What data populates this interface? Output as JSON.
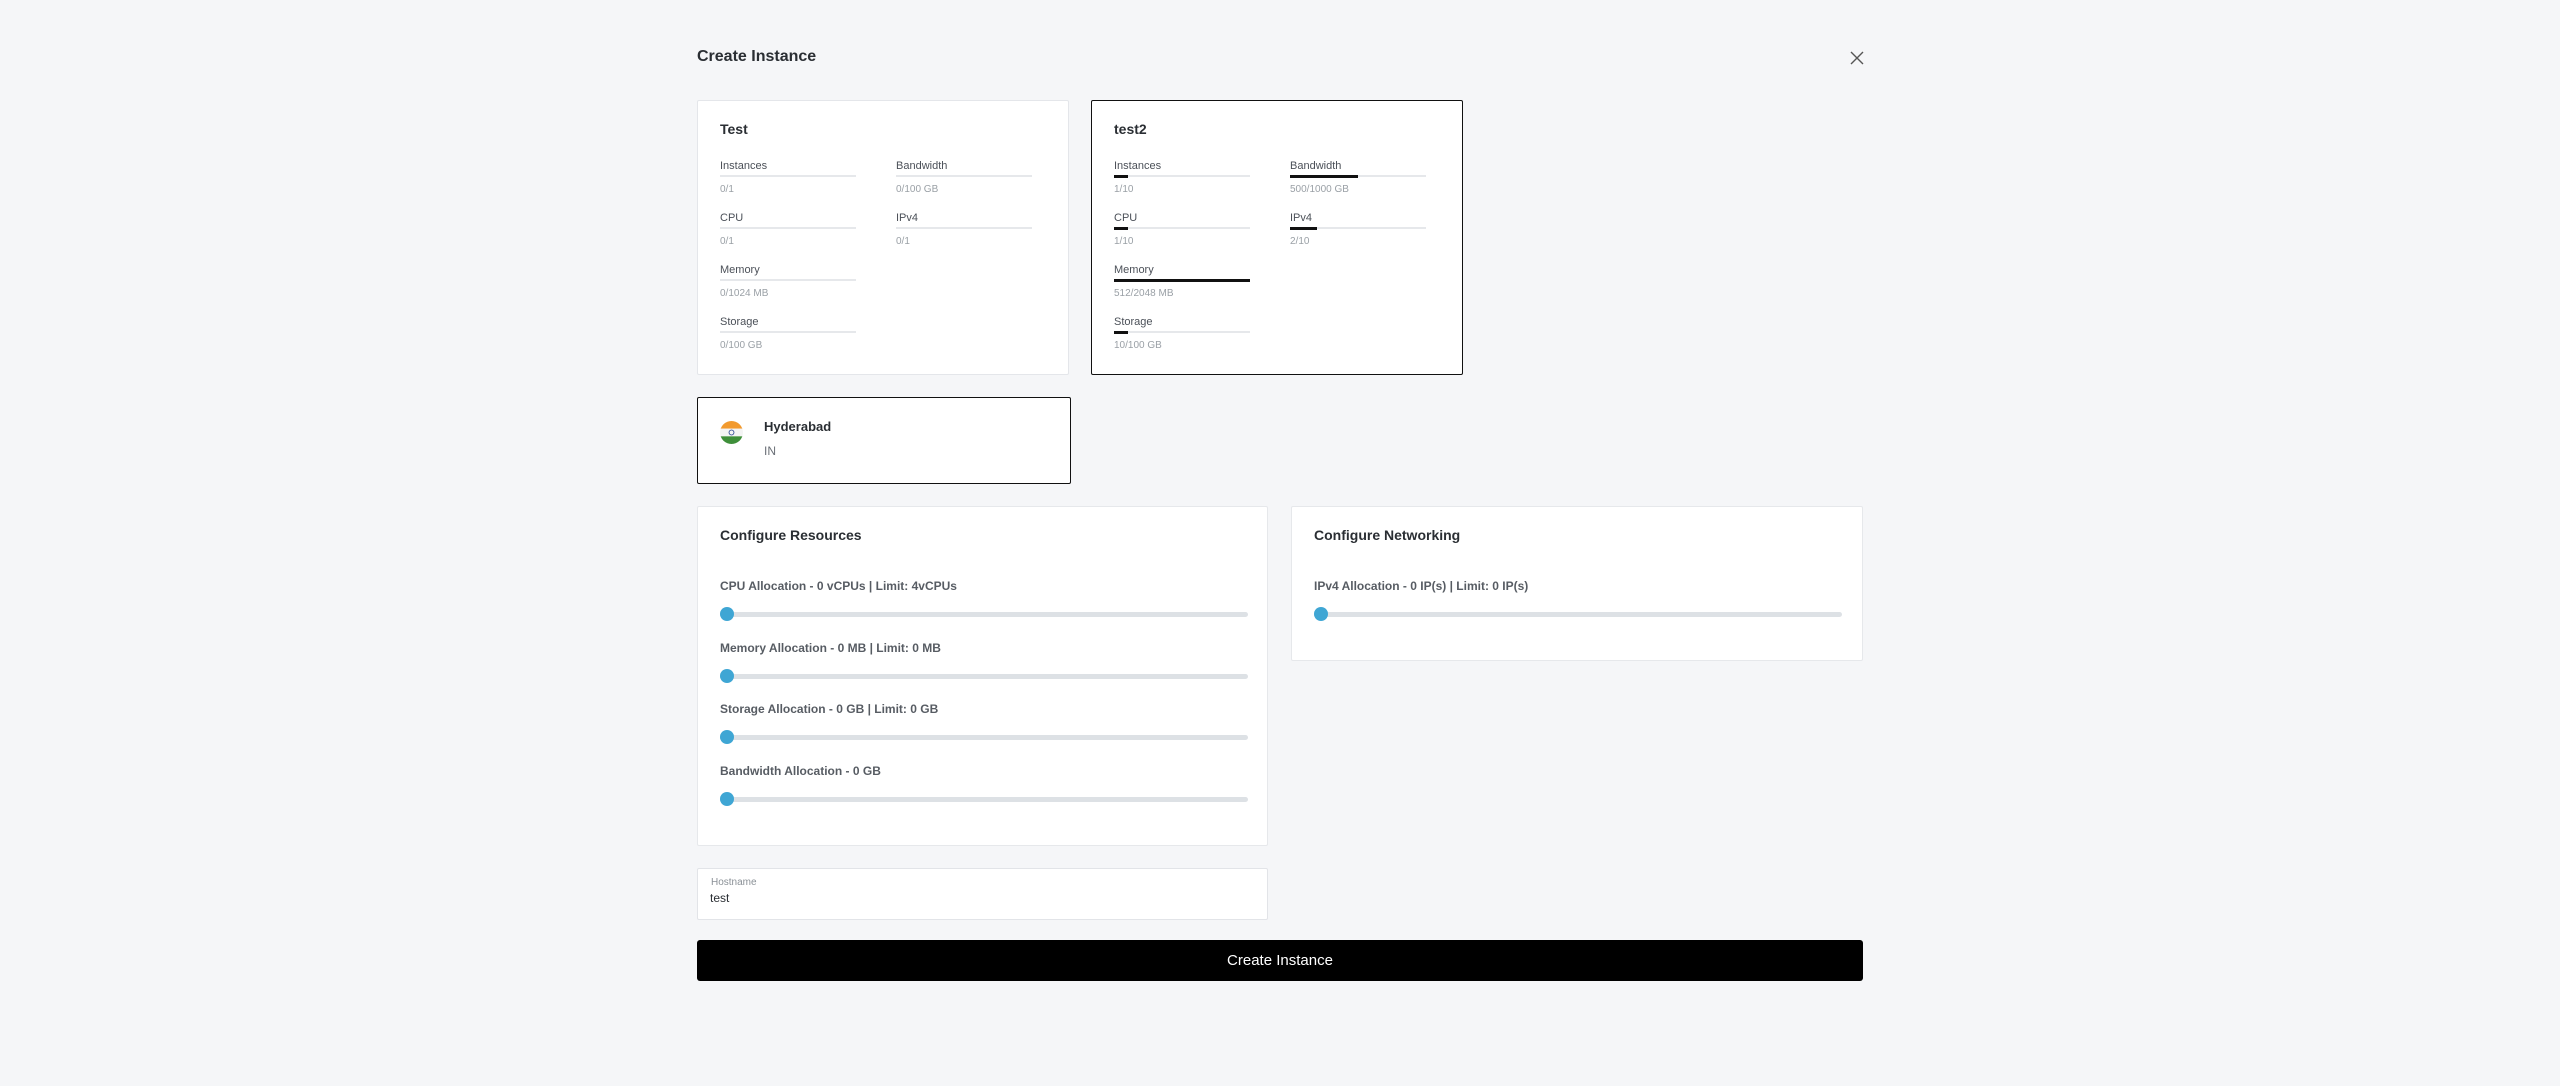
{
  "modal": {
    "title": "Create Instance"
  },
  "plans": [
    {
      "name": "Test",
      "selected": false,
      "resources": {
        "instances": {
          "label": "Instances",
          "value": "0/1",
          "fraction": 0
        },
        "bandwidth": {
          "label": "Bandwidth",
          "value": "0/100 GB",
          "fraction": 0
        },
        "cpu": {
          "label": "CPU",
          "value": "0/1",
          "fraction": 0
        },
        "ipv4": {
          "label": "IPv4",
          "value": "0/1",
          "fraction": 0
        },
        "memory": {
          "label": "Memory",
          "value": "0/1024 MB",
          "fraction": 0
        },
        "storage": {
          "label": "Storage",
          "value": "0/100 GB",
          "fraction": 0
        }
      }
    },
    {
      "name": "test2",
      "selected": true,
      "resources": {
        "instances": {
          "label": "Instances",
          "value": "1/10",
          "fraction": 0.1
        },
        "bandwidth": {
          "label": "Bandwidth",
          "value": "500/1000 GB",
          "fraction": 0.5
        },
        "cpu": {
          "label": "CPU",
          "value": "1/10",
          "fraction": 0.1
        },
        "ipv4": {
          "label": "IPv4",
          "value": "2/10",
          "fraction": 0.2
        },
        "memory": {
          "label": "Memory",
          "value": "512/2048 MB",
          "fraction": 1.0
        },
        "storage": {
          "label": "Storage",
          "value": "10/100 GB",
          "fraction": 0.1
        }
      }
    }
  ],
  "location": {
    "name": "Hyderabad",
    "code": "IN",
    "flag_icon": "india-flag-icon",
    "selected": true
  },
  "configure_resources": {
    "title": "Configure Resources",
    "sliders": [
      {
        "label": "CPU Allocation - 0 vCPUs | Limit: 4vCPUs",
        "value": 0
      },
      {
        "label": "Memory Allocation - 0 MB | Limit: 0 MB",
        "value": 0
      },
      {
        "label": "Storage Allocation - 0 GB | Limit: 0 GB",
        "value": 0
      },
      {
        "label": "Bandwidth Allocation - 0 GB",
        "value": 0
      }
    ]
  },
  "configure_networking": {
    "title": "Configure Networking",
    "sliders": [
      {
        "label": "IPv4 Allocation - 0 IP(s) | Limit: 0 IP(s)",
        "value": 0
      }
    ]
  },
  "hostname": {
    "label": "Hostname",
    "value": "test"
  },
  "submit": {
    "label": "Create Instance"
  },
  "colors": {
    "accent": "#3fa6d4",
    "button": "#000000",
    "background": "#f5f6f8"
  }
}
